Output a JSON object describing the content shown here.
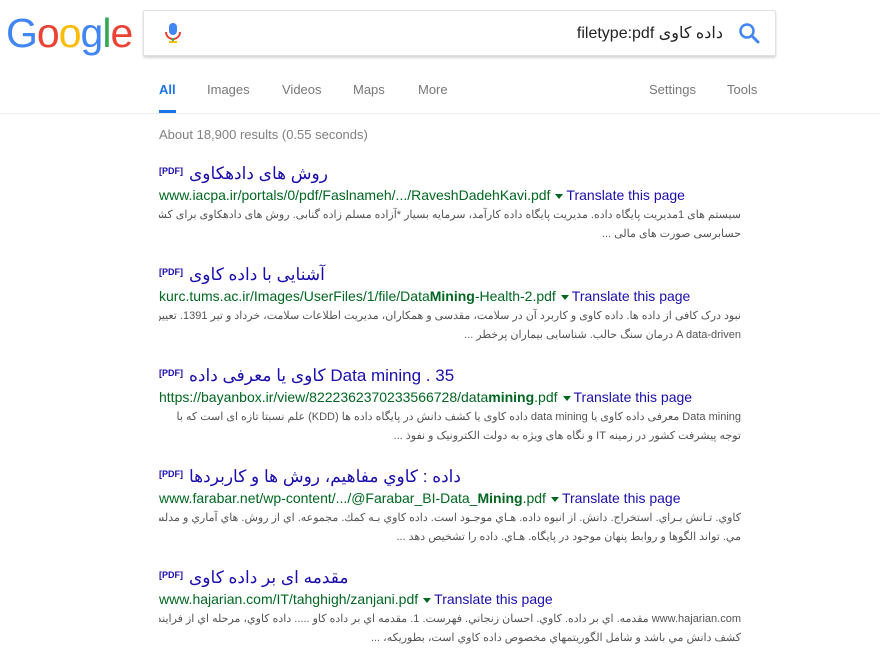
{
  "logo": {
    "letters": [
      "G",
      "o",
      "o",
      "g",
      "l",
      "e"
    ],
    "colors": [
      "#4285F4",
      "#EA4335",
      "#FBBC05",
      "#4285F4",
      "#34A853",
      "#EA4335"
    ]
  },
  "search": {
    "query": "داده کاوی filetype:pdf"
  },
  "tabs": [
    {
      "label": "All",
      "active": true
    },
    {
      "label": "Images"
    },
    {
      "label": "Videos"
    },
    {
      "label": "Maps"
    },
    {
      "label": "More"
    },
    {
      "label": "Settings"
    },
    {
      "label": "Tools"
    }
  ],
  "stats": "About 18,900 results (0.55 seconds)",
  "pdf_tag": "[PDF]",
  "translate_label": "Translate this page",
  "results": [
    {
      "title": "روش های دادهکاوی",
      "url_prefix": "www.iacpa.ir/portals/0/pdf/Faslnameh/.../RaveshDadehKavi.pdf",
      "url_bold": "",
      "url_suffix": "",
      "snippet1": "سیستم های 1مدیریت پایگاه داده. مدیریت پایگاه داده کارآمد، سرمایه بسیار *آزاده مسلم زاده گنابی. روش های دادهکاوی برای کشف تقلب در",
      "snippet2": "حسابرسی صورت های مالی ..."
    },
    {
      "title": "آشنایی با داده کاوی",
      "url_prefix": "kurc.tums.ac.ir/Images/UserFiles/1/file/Data",
      "url_bold": "Mining",
      "url_suffix": "-Health-2.pdf",
      "snippet1": "نبود درک کافی از داده ها. داده کاوی و کاربرد آن در سلامت، مقدسی و همکاران، مدیریت اطلاعات سلامت، خرداد و تیر 1391. تعیین نوع",
      "snippet2": "A data-driven درمان سنگ حالب. شناسایی بیماران پرخطر ..."
    },
    {
      "title": "Data mining . 35 کاوی یا معرفی داده",
      "url_prefix": "https://bayanbox.ir/view/8222362370233566728/data",
      "url_bold": "mining",
      "url_suffix": ".pdf",
      "snippet1": "Data mining معرفی داده کاوی یا data mining داده کاوی یا کشف دانش در پایگاه داده ها (KDD) علم نسبتا تازه ای است که با",
      "snippet2": "توجه پیشرفت کشور در زمینه IT و نگاه های ویژه به دولت الکترونیک و نفوذ ..."
    },
    {
      "title": "داده : كاوي مفاهيم، روش ها و كاربردها",
      "url_prefix": "www.farabar.net/wp-content/.../@Farabar_BI-Data_",
      "url_bold": "Mining",
      "url_suffix": ".pdf",
      "snippet1": "كاوي. تـانش بـراي. استخراج. دانش. از انبوه داده. هـاي موجـود است. داده كاوي بـه كمك. مجموعه. اي از روش. هاي آماري و مدلسازي،",
      "snippet2": "مي. تواند الگوها و روابط پنهان موجود در پايگاه. هـاي. داده را تشخيص دهد ..."
    },
    {
      "title": "مقدمه ای بر داده کاوی",
      "url_prefix": "www.hajarian.com/IT/tahghigh/zanjani.pdf",
      "url_bold": "",
      "url_suffix": "",
      "snippet1": "www.hajarian.com مقدمه. اي بر داده. كاوي. احسان زنجاني. فهرست. 1. مقدمه اي بر داده كاو ..... داده كاوي، مرحله اي از فرايند",
      "snippet2": "كشف دانش مي باشد و شامل الگوريتمهاي مخصوص داده كاوي است، بطوريكه، ..."
    }
  ]
}
